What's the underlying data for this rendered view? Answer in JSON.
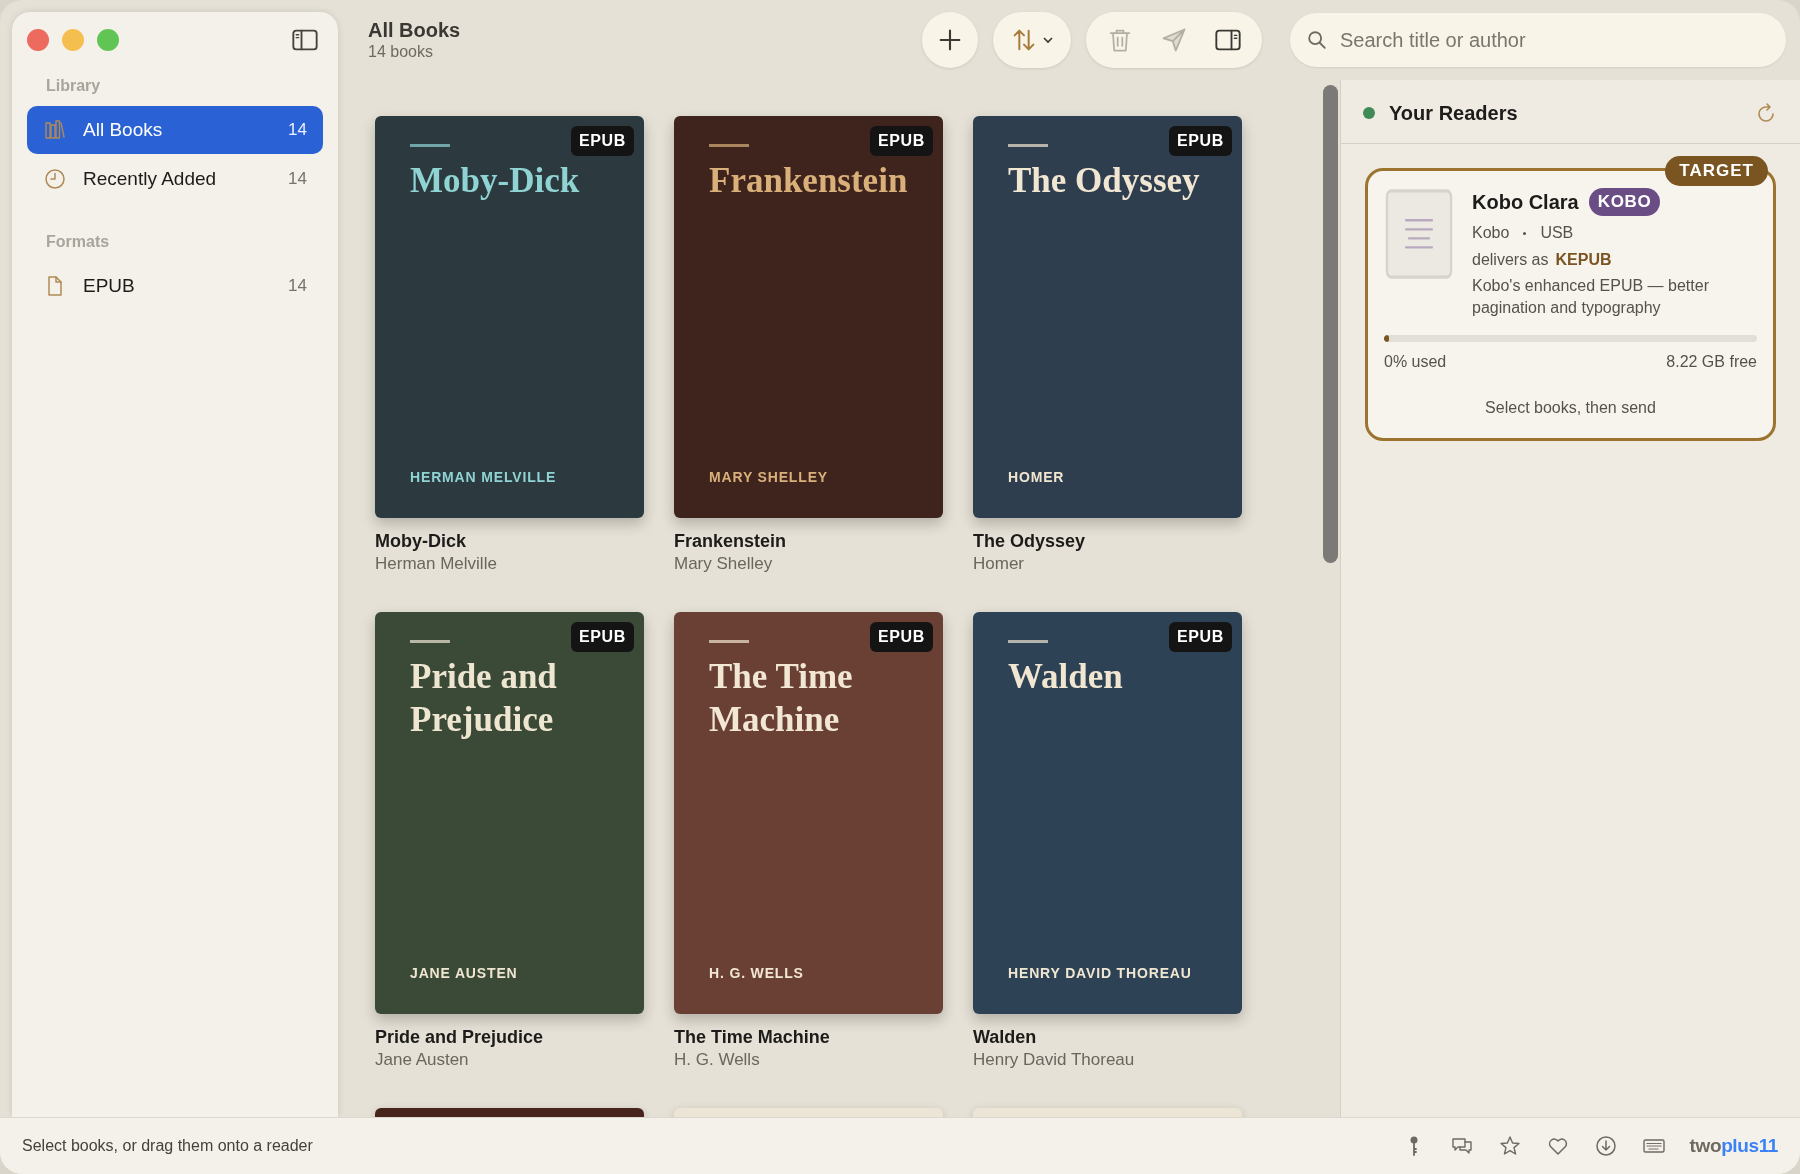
{
  "sidebar": {
    "sections": [
      {
        "title": "Library",
        "items": [
          {
            "label": "All Books",
            "count": "14",
            "selected": true
          },
          {
            "label": "Recently Added",
            "count": "14",
            "selected": false
          }
        ]
      },
      {
        "title": "Formats",
        "items": [
          {
            "label": "EPUB",
            "count": "14",
            "selected": false
          }
        ]
      }
    ]
  },
  "header": {
    "title": "All Books",
    "subtitle": "14 books"
  },
  "toolbar": {
    "buttons": [
      {
        "kind": "add",
        "disabled": false
      },
      {
        "kind": "sort",
        "disabled": false
      },
      {
        "kind": "delete",
        "disabled": true
      },
      {
        "kind": "send",
        "disabled": true
      },
      {
        "kind": "inspector",
        "disabled": false
      }
    ]
  },
  "search": {
    "placeholder": "Search title or author"
  },
  "books": [
    {
      "cover_title": "Moby-Dick",
      "cover_author": "HERMAN MELVILLE",
      "badge": "EPUB",
      "title": "Moby-Dick",
      "author": "Herman Melville",
      "color": "#2c3a40",
      "accent": {
        "color": "#8fd3d3"
      }
    },
    {
      "cover_title": "Frankenstein",
      "cover_author": "MARY SHELLEY",
      "badge": "EPUB",
      "title": "Frankenstein",
      "author": "Mary Shelley",
      "color": "#3f241d",
      "accent": {
        "color": "#d9b07a"
      }
    },
    {
      "cover_title": "The Odyssey",
      "cover_author": "HOMER",
      "badge": "EPUB",
      "title": "The Odyssey",
      "author": "Homer",
      "color": "#2e3e4f",
      "accent": {
        "color": "#f0e6d2"
      }
    },
    {
      "cover_title": "Pride and Prejudice",
      "cover_author": "JANE AUSTEN",
      "badge": "EPUB",
      "title": "Pride and Prejudice",
      "author": "Jane Austen",
      "color": "#3a4a37",
      "accent": {
        "color": "#efe6d2"
      }
    },
    {
      "cover_title": "The Time Machine",
      "cover_author": "H. G. WELLS",
      "badge": "EPUB",
      "title": "The Time Machine",
      "author": "H. G. Wells",
      "color": "#6a4034",
      "accent": {
        "color": "#f2e6d4"
      }
    },
    {
      "cover_title": "Walden",
      "cover_author": "HENRY DAVID THOREAU",
      "badge": "EPUB",
      "title": "Walden",
      "author": "Henry David Thoreau",
      "color": "#2e4256",
      "accent": {
        "color": "#f0e6d2"
      }
    }
  ],
  "partial_books": [
    {
      "color": "#47251c"
    },
    {
      "color": "#ece5d6"
    },
    {
      "color": "#ece5d6"
    }
  ],
  "readers": {
    "title": "Your Readers",
    "devices": [
      {
        "tag": "TARGET",
        "name": "Kobo Clara",
        "badge": "KOBO",
        "brand": "Kobo",
        "connection": "USB",
        "delivers_label": "delivers as",
        "format": "KEPUB",
        "description": "Kobo's enhanced EPUB — better pagination and typography",
        "level": 0.005,
        "used": "0% used",
        "free": "8.22 GB free",
        "hint": "Select books, then send"
      }
    ]
  },
  "status_bar": {
    "text": "Select books, or drag them onto a reader",
    "brand_left": "two",
    "brand_right": "plus11"
  }
}
